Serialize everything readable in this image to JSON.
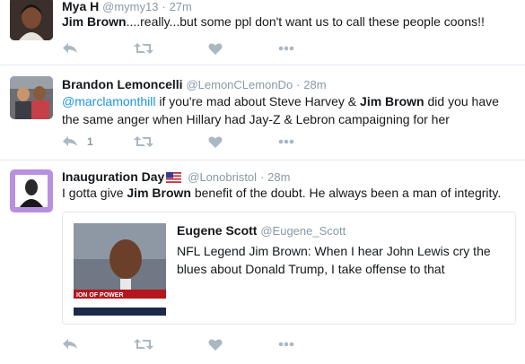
{
  "tweets": [
    {
      "name": "Mya H",
      "handle": "@mymy13",
      "sep": "·",
      "time": "27m",
      "text_parts": [
        "Jim Brown",
        "....really...but some ppl don't want us to call these people coons!!"
      ],
      "reply_count": ""
    },
    {
      "name": "Brandon Lemoncelli",
      "handle": "@LemonCLemonDo",
      "sep": "·",
      "time": "28m",
      "text_parts": [
        "@marclamonthill",
        " if you're mad about Steve Harvey & ",
        "Jim Brown",
        " did you have the same anger when Hillary had Jay-Z & Lebron campaigning for her"
      ],
      "reply_count": "1"
    },
    {
      "name": "Inauguration Day",
      "handle": "@Lonobristol",
      "sep": "·",
      "time": "28m",
      "text_parts": [
        "I gotta give ",
        "Jim Brown",
        " benefit of the doubt. He always been a man of integrity."
      ],
      "reply_count": "",
      "card": {
        "name": "Eugene Scott",
        "handle": "@Eugene_Scott",
        "text": "NFL Legend Jim Brown: When I hear John Lewis cry the blues about Donald Trump, I take offense to that",
        "image_caption": "ION OF POWER"
      }
    }
  ],
  "icons": [
    "reply-icon",
    "retweet-icon",
    "like-icon",
    "more-icon",
    "us-flag-icon"
  ],
  "colors": {
    "link": "#1b95e0",
    "muted": "#8899a6",
    "icon": "#aab8c2",
    "border": "#e1e8ed"
  }
}
